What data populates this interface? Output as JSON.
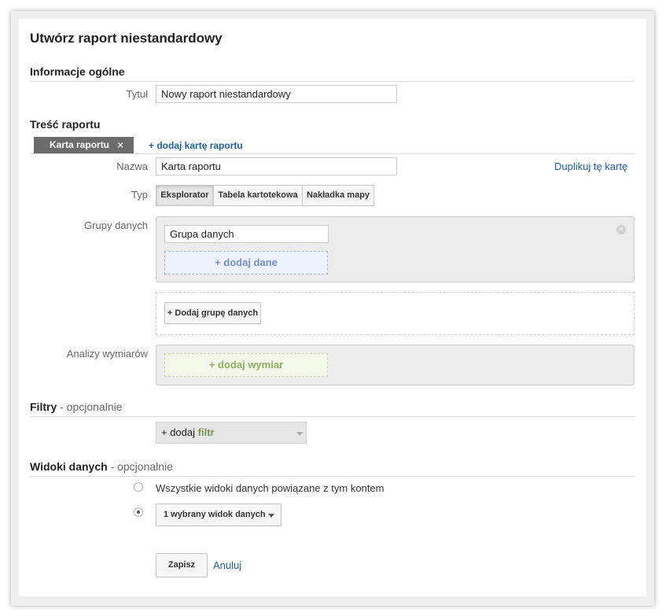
{
  "page": {
    "title": "Utwórz raport niestandardowy"
  },
  "general": {
    "heading": "Informacje ogólne",
    "title_label": "Tytuł",
    "title_value": "Nowy raport niestandardowy"
  },
  "content": {
    "heading": "Treść raportu",
    "tabs": [
      {
        "label": "Karta raportu",
        "close_icon": "×"
      }
    ],
    "add_tab_label": "+ dodaj kartę raportu",
    "name_label": "Nazwa",
    "name_value": "Karta raportu",
    "duplicate_label": "Duplikuj tę kartę",
    "type_label": "Typ",
    "types": [
      {
        "label": "Eksplorator",
        "selected": true
      },
      {
        "label": "Tabela kartotekowa",
        "selected": false
      },
      {
        "label": "Nakładka mapy",
        "selected": false
      }
    ],
    "metric_groups_label": "Grupy danych",
    "metric_group_name": "Grupa danych",
    "remove_group_icon": "×",
    "add_metric_label": "+ dodaj dane",
    "add_metric_group_label": "+ Dodaj grupę danych",
    "dimension_drilldowns_label": "Analizy wymiarów",
    "add_dimension_label": "+ dodaj wymiar"
  },
  "filters": {
    "heading": "Filtry",
    "optional": "- opcjonalnie",
    "add_prefix": "+ dodaj",
    "add_word": "filtr",
    "colors": {
      "filter_word": "#7a9450"
    }
  },
  "views": {
    "heading": "Widoki danych",
    "optional": "- opcjonalnie",
    "all_views_label": "Wszystkie widoki danych powiązane z tym kontem",
    "all_views_selected": false,
    "selected_views_label": "1 wybrany widok danych",
    "selected_views_selected": true
  },
  "actions": {
    "save_label": "Zapisz",
    "cancel_label": "Anuluj"
  },
  "colors": {
    "link": "#1e5fa3",
    "tab_active_bg": "#6b6b6b"
  }
}
